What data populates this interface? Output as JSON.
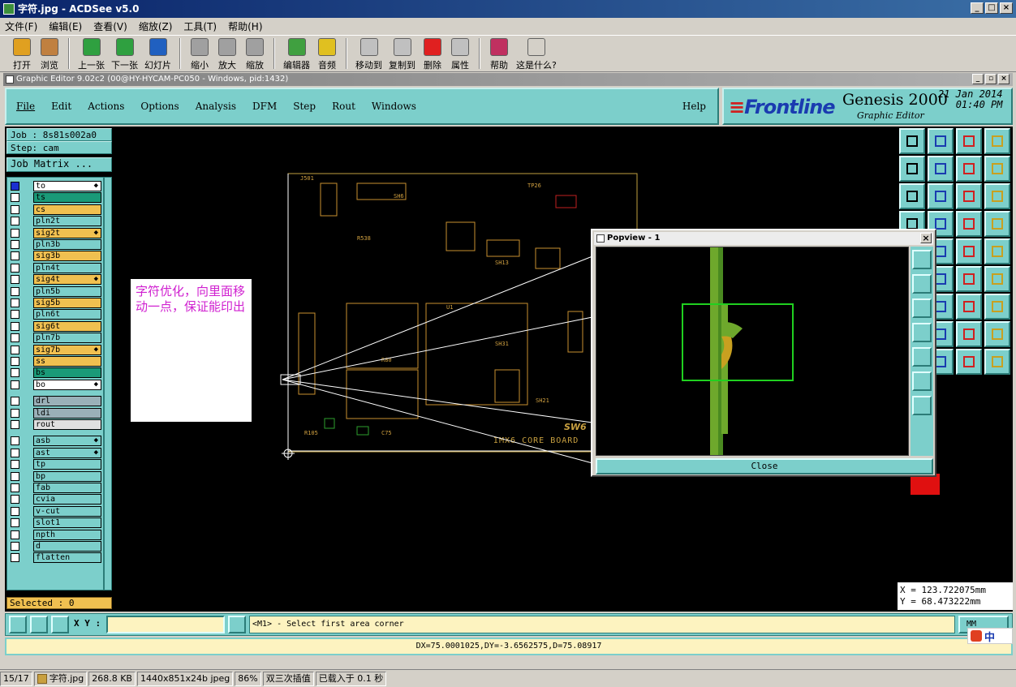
{
  "acdsee": {
    "title": "字符.jpg - ACDSee v5.0",
    "menu": [
      "文件(F)",
      "编辑(E)",
      "查看(V)",
      "缩放(Z)",
      "工具(T)",
      "帮助(H)"
    ],
    "toolbar": [
      {
        "label": "打开",
        "icon": "open-folder-icon",
        "color": "#e0a020"
      },
      {
        "label": "浏览",
        "icon": "browse-icon",
        "color": "#c08040"
      },
      {
        "label": "上一张",
        "icon": "previous-icon",
        "color": "#2fa040"
      },
      {
        "label": "下一张",
        "icon": "next-icon",
        "color": "#2fa040"
      },
      {
        "label": "幻灯片",
        "icon": "slideshow-icon",
        "color": "#2060c0"
      },
      {
        "label": "缩小",
        "icon": "zoom-out-icon",
        "color": "#a0a0a0"
      },
      {
        "label": "放大",
        "icon": "zoom-in-icon",
        "color": "#a0a0a0"
      },
      {
        "label": "缩放",
        "icon": "zoom-icon",
        "color": "#a0a0a0"
      },
      {
        "label": "编辑器",
        "icon": "editor-icon",
        "color": "#40a040"
      },
      {
        "label": "音频",
        "icon": "audio-icon",
        "color": "#e0c020"
      },
      {
        "label": "移动到",
        "icon": "move-to-icon",
        "color": "#c0c0c0"
      },
      {
        "label": "复制到",
        "icon": "copy-to-icon",
        "color": "#c0c0c0"
      },
      {
        "label": "删除",
        "icon": "delete-icon",
        "color": "#e02020"
      },
      {
        "label": "属性",
        "icon": "properties-icon",
        "color": "#c0c0c0"
      },
      {
        "label": "帮助",
        "icon": "help-book-icon",
        "color": "#c03060"
      },
      {
        "label": "这是什么?",
        "icon": "whats-this-icon",
        "color": "#d4d0c8"
      }
    ],
    "status": {
      "index": "15/17",
      "file": "字符.jpg",
      "size": "268.8 KB",
      "dims": "1440x851x24b jpeg",
      "zoom": "86%",
      "mode": "双三次插值",
      "load": "已载入于 0.1 秒"
    }
  },
  "genesis": {
    "window_title": "Graphic Editor 9.02c2 (00@HY-HYCAM-PC050 - Windows, pid:1432)",
    "menu": [
      "File",
      "Edit",
      "Actions",
      "Options",
      "Analysis",
      "DFM",
      "Step",
      "Rout",
      "Windows"
    ],
    "help": "Help",
    "logo": "Frontline",
    "product": "Genesis 2000",
    "subtitle": "Graphic Editor",
    "date": "21 Jan 2014",
    "time": "01:40 PM",
    "job": "Job : 8s81s002a0",
    "step": "Step: cam",
    "job_matrix": "Job Matrix ...",
    "layers": [
      {
        "name": "to",
        "color": "#ffffff",
        "checked": true,
        "marker": "◆"
      },
      {
        "name": "ts",
        "color": "#1a9a78"
      },
      {
        "name": "cs",
        "color": "#f0c050"
      },
      {
        "name": "pln2t",
        "color": "#7ccfcb"
      },
      {
        "name": "sig2t",
        "color": "#f0c050",
        "marker": "◆"
      },
      {
        "name": "pln3b",
        "color": "#7ccfcb"
      },
      {
        "name": "sig3b",
        "color": "#f0c050"
      },
      {
        "name": "pln4t",
        "color": "#7ccfcb"
      },
      {
        "name": "sig4t",
        "color": "#f0c050",
        "marker": "◆"
      },
      {
        "name": "pln5b",
        "color": "#7ccfcb"
      },
      {
        "name": "sig5b",
        "color": "#f0c050"
      },
      {
        "name": "pln6t",
        "color": "#7ccfcb"
      },
      {
        "name": "sig6t",
        "color": "#f0c050"
      },
      {
        "name": "pln7b",
        "color": "#7ccfcb"
      },
      {
        "name": "sig7b",
        "color": "#f0c050",
        "marker": "◆"
      },
      {
        "name": "ss",
        "color": "#f0c050"
      },
      {
        "name": "bs",
        "color": "#1a9a78"
      },
      {
        "name": "bo",
        "color": "#ffffff",
        "marker": "◆"
      },
      {
        "name": "drl",
        "color": "#9ab0b8"
      },
      {
        "name": "ldi",
        "color": "#9ab0b8"
      },
      {
        "name": "rout",
        "color": "#e0e0e0"
      },
      {
        "name": "asb",
        "color": "#7ccfcb",
        "marker": "◆"
      },
      {
        "name": "ast",
        "color": "#7ccfcb",
        "marker": "◆"
      },
      {
        "name": "tp",
        "color": "#7ccfcb"
      },
      {
        "name": "bp",
        "color": "#7ccfcb"
      },
      {
        "name": "fab",
        "color": "#7ccfcb"
      },
      {
        "name": "cvia",
        "color": "#7ccfcb"
      },
      {
        "name": "v-cut",
        "color": "#7ccfcb"
      },
      {
        "name": "slot1",
        "color": "#7ccfcb"
      },
      {
        "name": "npth",
        "color": "#7ccfcb"
      },
      {
        "name": "d",
        "color": "#7ccfcb"
      },
      {
        "name": "flatten",
        "color": "#7ccfcb"
      }
    ],
    "selected": "Selected : 0",
    "note": "字符优化，向里面移动一点，保证能印出",
    "board_label": "IMX6 CORE BOARD",
    "board_ref": "SW6",
    "popview_title": "Popview - 1",
    "popview_close": "Close",
    "coord_x": "X = 123.722075mm",
    "coord_y": "Y = 68.473222mm",
    "xy_label": "X Y :",
    "message": "<M1> - Select first area corner",
    "unit": "MM",
    "measure": "DX=75.0001025,DY=-3.6562575,D=75.08917",
    "ime": "中"
  }
}
